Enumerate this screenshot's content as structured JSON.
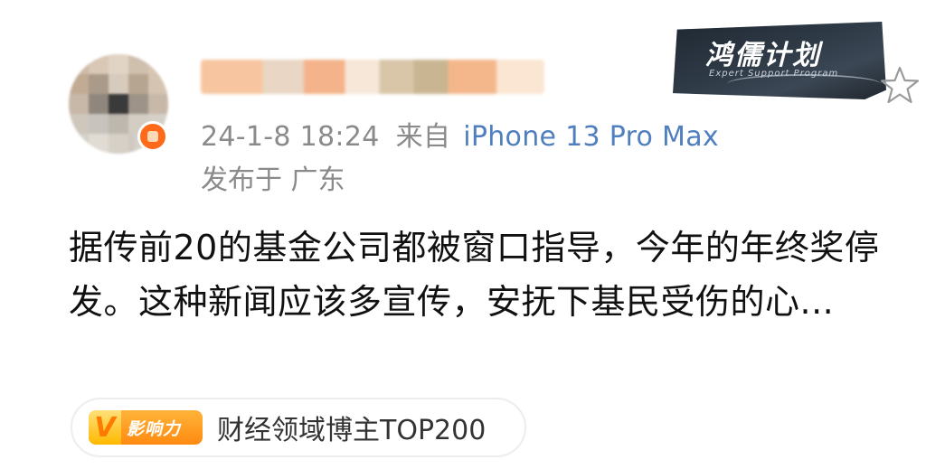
{
  "post": {
    "timestamp": "24-1-8 18:24",
    "from_label": "来自",
    "source": "iPhone 13 Pro Max",
    "location": "发布于 广东",
    "text": "据传前20的基金公司都被窗口指导，今年的年终奖停发。这种新闻应该多宣传，安抚下基民受伤的心..."
  },
  "watermark": {
    "title": "鸿儒计划",
    "subtitle": "Expert Support Program"
  },
  "tag": {
    "logo_letter": "V",
    "logo_text": "影响力",
    "label": "财经领域博主TOP200"
  },
  "icons": {
    "favorite": "star-outline-icon"
  },
  "colors": {
    "source_link": "#4f7fbf",
    "meta_gray": "#8a8a8a",
    "badge_orange": "#ff6a1a",
    "tag_orange": "#ff8a10"
  }
}
